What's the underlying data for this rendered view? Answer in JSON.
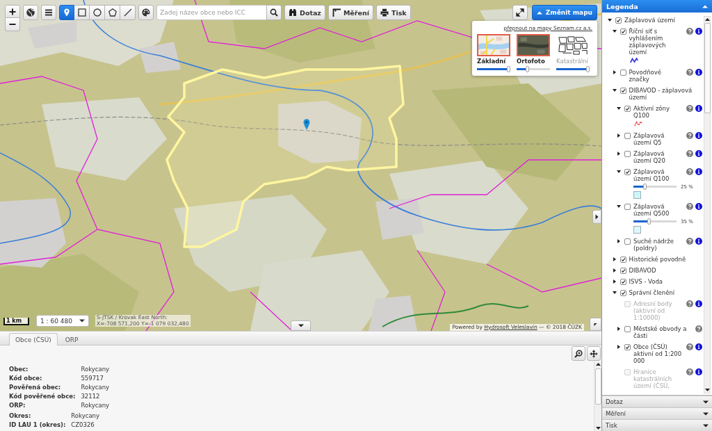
{
  "map_toolbar": {
    "draw_tools": [
      {
        "kind": "point",
        "selected": true
      },
      {
        "kind": "rectangle",
        "selected": false
      },
      {
        "kind": "circle",
        "selected": false
      },
      {
        "kind": "polygon",
        "selected": false
      },
      {
        "kind": "line",
        "selected": false
      }
    ],
    "search": {
      "placeholder": "Zadej název obce nebo ICC"
    },
    "buttons": [
      {
        "kind": "query",
        "label": "Dotaz"
      },
      {
        "kind": "measure",
        "label": "Měření"
      },
      {
        "kind": "print",
        "label": "Tisk"
      }
    ],
    "change_map": {
      "label": "Změnit mapu",
      "expanded": true
    }
  },
  "basemap_switcher": {
    "link": "přepnout na mapy Seznam.cz a.s.",
    "maps": [
      {
        "kind": "basic",
        "label": "Základní",
        "selected": true,
        "level": 1
      },
      {
        "kind": "ortho",
        "label": "Ortofoto",
        "selected": true,
        "level": 0.3
      },
      {
        "kind": "cadastral",
        "label": "Katastrální",
        "selected": false,
        "level": 1
      }
    ]
  },
  "map_overlays": {
    "scale_bar": "1 km",
    "scale": "1 : 60 480",
    "coordinate_system": "S-JTSK / Krovak East North:",
    "coordinates": "X=-708 571,200 Y=-1 079 032,480",
    "attribution": {
      "prefix": "Powered by",
      "link": "Hydrosoft Veleslavín",
      "suffix": "— © 2018 ČÚZK"
    }
  },
  "legend": {
    "title": "Legenda",
    "expanded": true,
    "items": [
      {
        "label": "Záplavová území",
        "kind": "group",
        "expanded": true,
        "checked": true,
        "disabled": false,
        "help": false,
        "info": false,
        "children": [
          {
            "label": "Říční síť s vyhlášením záplavových území",
            "kind": "group",
            "expanded": true,
            "checked": true,
            "disabled": false,
            "help": true,
            "info": true,
            "symbol": {
              "kind": "line",
              "color": "#3d3de0"
            }
          },
          {
            "label": "Povodňové značky",
            "kind": "group",
            "expanded": false,
            "checked": false,
            "disabled": false,
            "help": true,
            "info": true
          },
          {
            "label": "DIBAVOD - záplavová území",
            "kind": "group",
            "expanded": true,
            "checked": true,
            "disabled": false,
            "help": false,
            "info": false,
            "children": [
              {
                "label": "Aktivní zóny Q100",
                "kind": "group",
                "expanded": true,
                "checked": true,
                "disabled": false,
                "help": true,
                "info": true,
                "symbol": {
                  "kind": "dashed-line",
                  "color": "#f05a5a"
                }
              },
              {
                "label": "Záplavová území Q5",
                "kind": "group",
                "expanded": false,
                "checked": false,
                "disabled": false,
                "help": true,
                "info": true
              },
              {
                "label": "Záplavová území Q20",
                "kind": "group",
                "expanded": false,
                "checked": false,
                "disabled": false,
                "help": true,
                "info": true
              },
              {
                "label": "Záplavová území Q100",
                "kind": "group",
                "expanded": true,
                "checked": true,
                "disabled": false,
                "help": true,
                "info": true,
                "opacity": {
                  "level": 0.25,
                  "reading": "25 %"
                },
                "symbol": {
                  "kind": "fill",
                  "color": "#ccf6fa"
                }
              },
              {
                "label": "Záplavová území Q500",
                "kind": "group",
                "expanded": true,
                "checked": false,
                "disabled": false,
                "help": true,
                "info": true,
                "opacity": {
                  "level": 0.35,
                  "reading": "35 %"
                },
                "symbol": {
                  "kind": "fill",
                  "color": "#ddf7fb"
                }
              },
              {
                "label": "Suché nádrže (poldry)",
                "kind": "group",
                "expanded": false,
                "checked": false,
                "disabled": false,
                "help": true,
                "info": true
              }
            ]
          },
          {
            "label": "Historické povodně",
            "kind": "group",
            "expanded": false,
            "checked": true,
            "disabled": false,
            "help": false,
            "info": false
          },
          {
            "label": "DIBAVOD",
            "kind": "group",
            "expanded": false,
            "checked": true,
            "disabled": false,
            "help": false,
            "info": false
          },
          {
            "label": "ISVS - Voda",
            "kind": "group",
            "expanded": false,
            "checked": true,
            "disabled": false,
            "help": false,
            "info": false
          },
          {
            "label": "Správní členění",
            "kind": "group",
            "expanded": true,
            "checked": true,
            "disabled": false,
            "help": false,
            "info": false,
            "children": [
              {
                "label": "Adresní body (aktivní od 1:10000)",
                "kind": "layer",
                "checked": false,
                "disabled": true,
                "help": true,
                "info": true
              },
              {
                "label": "Městské obvody a části",
                "kind": "group",
                "expanded": false,
                "checked": false,
                "disabled": false,
                "help": true,
                "info": false
              },
              {
                "label": "Obce (ČSÚ) aktivní od 1:200 000",
                "kind": "group",
                "expanded": false,
                "checked": true,
                "disabled": false,
                "help": true,
                "info": true
              },
              {
                "label": "Hranice katastrálních území (ČSÚ,",
                "kind": "layer",
                "checked": false,
                "disabled": true,
                "help": true,
                "info": true
              }
            ]
          }
        ]
      }
    ]
  },
  "panels": [
    {
      "label": "Dotaz",
      "expanded": false
    },
    {
      "label": "Měření",
      "expanded": false
    },
    {
      "label": "Tisk",
      "expanded": false
    }
  ],
  "info_panel": {
    "tabs": [
      {
        "label": "Obce (ČSÚ)",
        "selected": true
      },
      {
        "label": "ORP",
        "selected": false
      }
    ],
    "tables": [
      {
        "rows": [
          {
            "label": "Obec:",
            "value": "Rokycany"
          },
          {
            "label": "Kód obce:",
            "value": "559717"
          },
          {
            "label": "Pověřená obec:",
            "value": "Rokycany"
          },
          {
            "label": "Kód pověřené obce:",
            "value": "32112"
          },
          {
            "label": "ORP:",
            "value": "Rokycany"
          }
        ]
      },
      {
        "rows": [
          {
            "label": "Okres:",
            "value": "Rokycany"
          },
          {
            "label": "ID LAU 1 (okres):",
            "value": "CZ0326"
          }
        ]
      }
    ]
  }
}
